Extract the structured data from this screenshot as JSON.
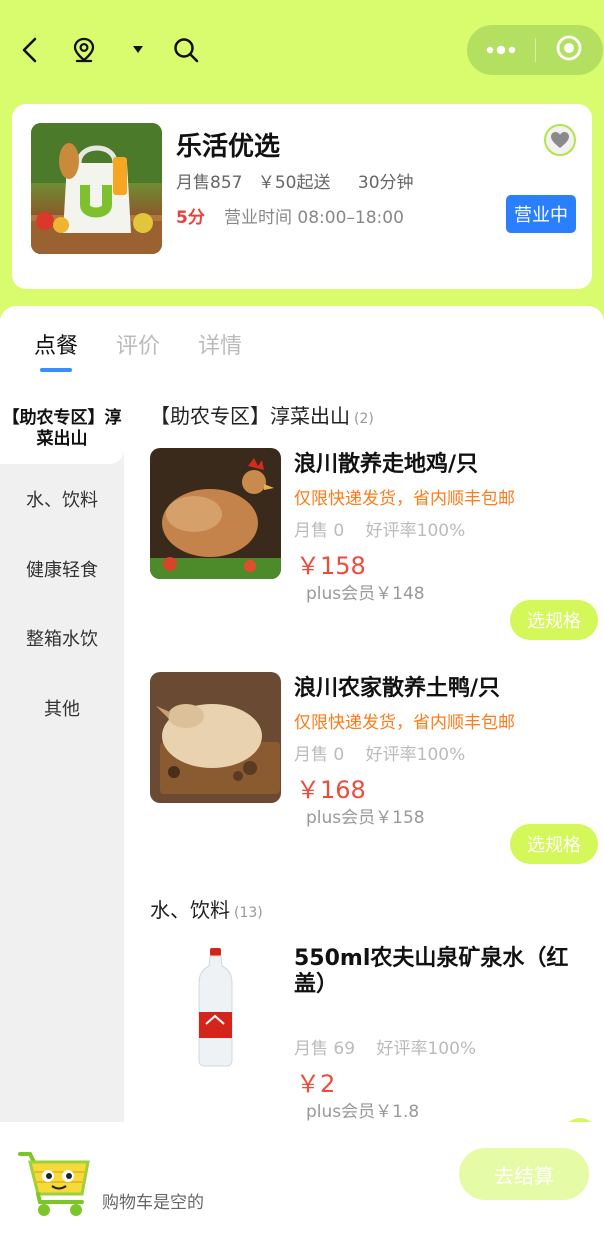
{
  "nav": {
    "back_icon": "back-arrow-icon",
    "location_icon": "location-pin-icon",
    "dropdown_icon": "caret-down-icon",
    "search_icon": "search-icon",
    "more_icon": "more-dots-icon",
    "close_icon": "target-icon"
  },
  "store": {
    "name": "乐活优选",
    "monthly_sales": "月售857",
    "min_order": "￥50起送",
    "delivery_time": "30分钟",
    "score": "5分",
    "hours": "营业时间 08:00–18:00",
    "status": "营业中",
    "status_color": "#2a7fff"
  },
  "tabs": [
    "点餐",
    "评价",
    "详情"
  ],
  "sidebar": {
    "items": [
      {
        "label": "【助农专区】淳菜出山",
        "active": true
      },
      {
        "label": "水、饮料"
      },
      {
        "label": "健康轻食"
      },
      {
        "label": "整箱水饮"
      },
      {
        "label": "其他"
      }
    ]
  },
  "sections": [
    {
      "title": "【助农专区】淳菜出山",
      "count": "(2)",
      "products": [
        {
          "name": "浪川散养走地鸡/只",
          "tag": "仅限快递发货，省内顺丰包邮",
          "sales": "月售 0",
          "rating": "好评率100%",
          "price": "￥158",
          "plus_price": "plus会员￥148",
          "button": "选规格"
        },
        {
          "name": "浪川农家散养土鸭/只",
          "tag": "仅限快递发货，省内顺丰包邮",
          "sales": "月售 0",
          "rating": "好评率100%",
          "price": "￥168",
          "plus_price": "plus会员￥158",
          "button": "选规格"
        }
      ]
    },
    {
      "title": "水、饮料",
      "count": "(13)",
      "products": [
        {
          "name": "550ml农夫山泉矿泉水（红盖）",
          "sales": "月售 69",
          "rating": "好评率100%",
          "price": "￥2",
          "plus_price": "plus会员￥1.8"
        }
      ]
    }
  ],
  "cart": {
    "icon": "shopping-cart-icon",
    "empty_text": "购物车是空的",
    "checkout_label": "去结算"
  },
  "colors": {
    "header_bg": "#d9fc6e",
    "price": "#f04a3a",
    "tag": "#ff7a1a",
    "accent_button": "#d4f85a"
  }
}
